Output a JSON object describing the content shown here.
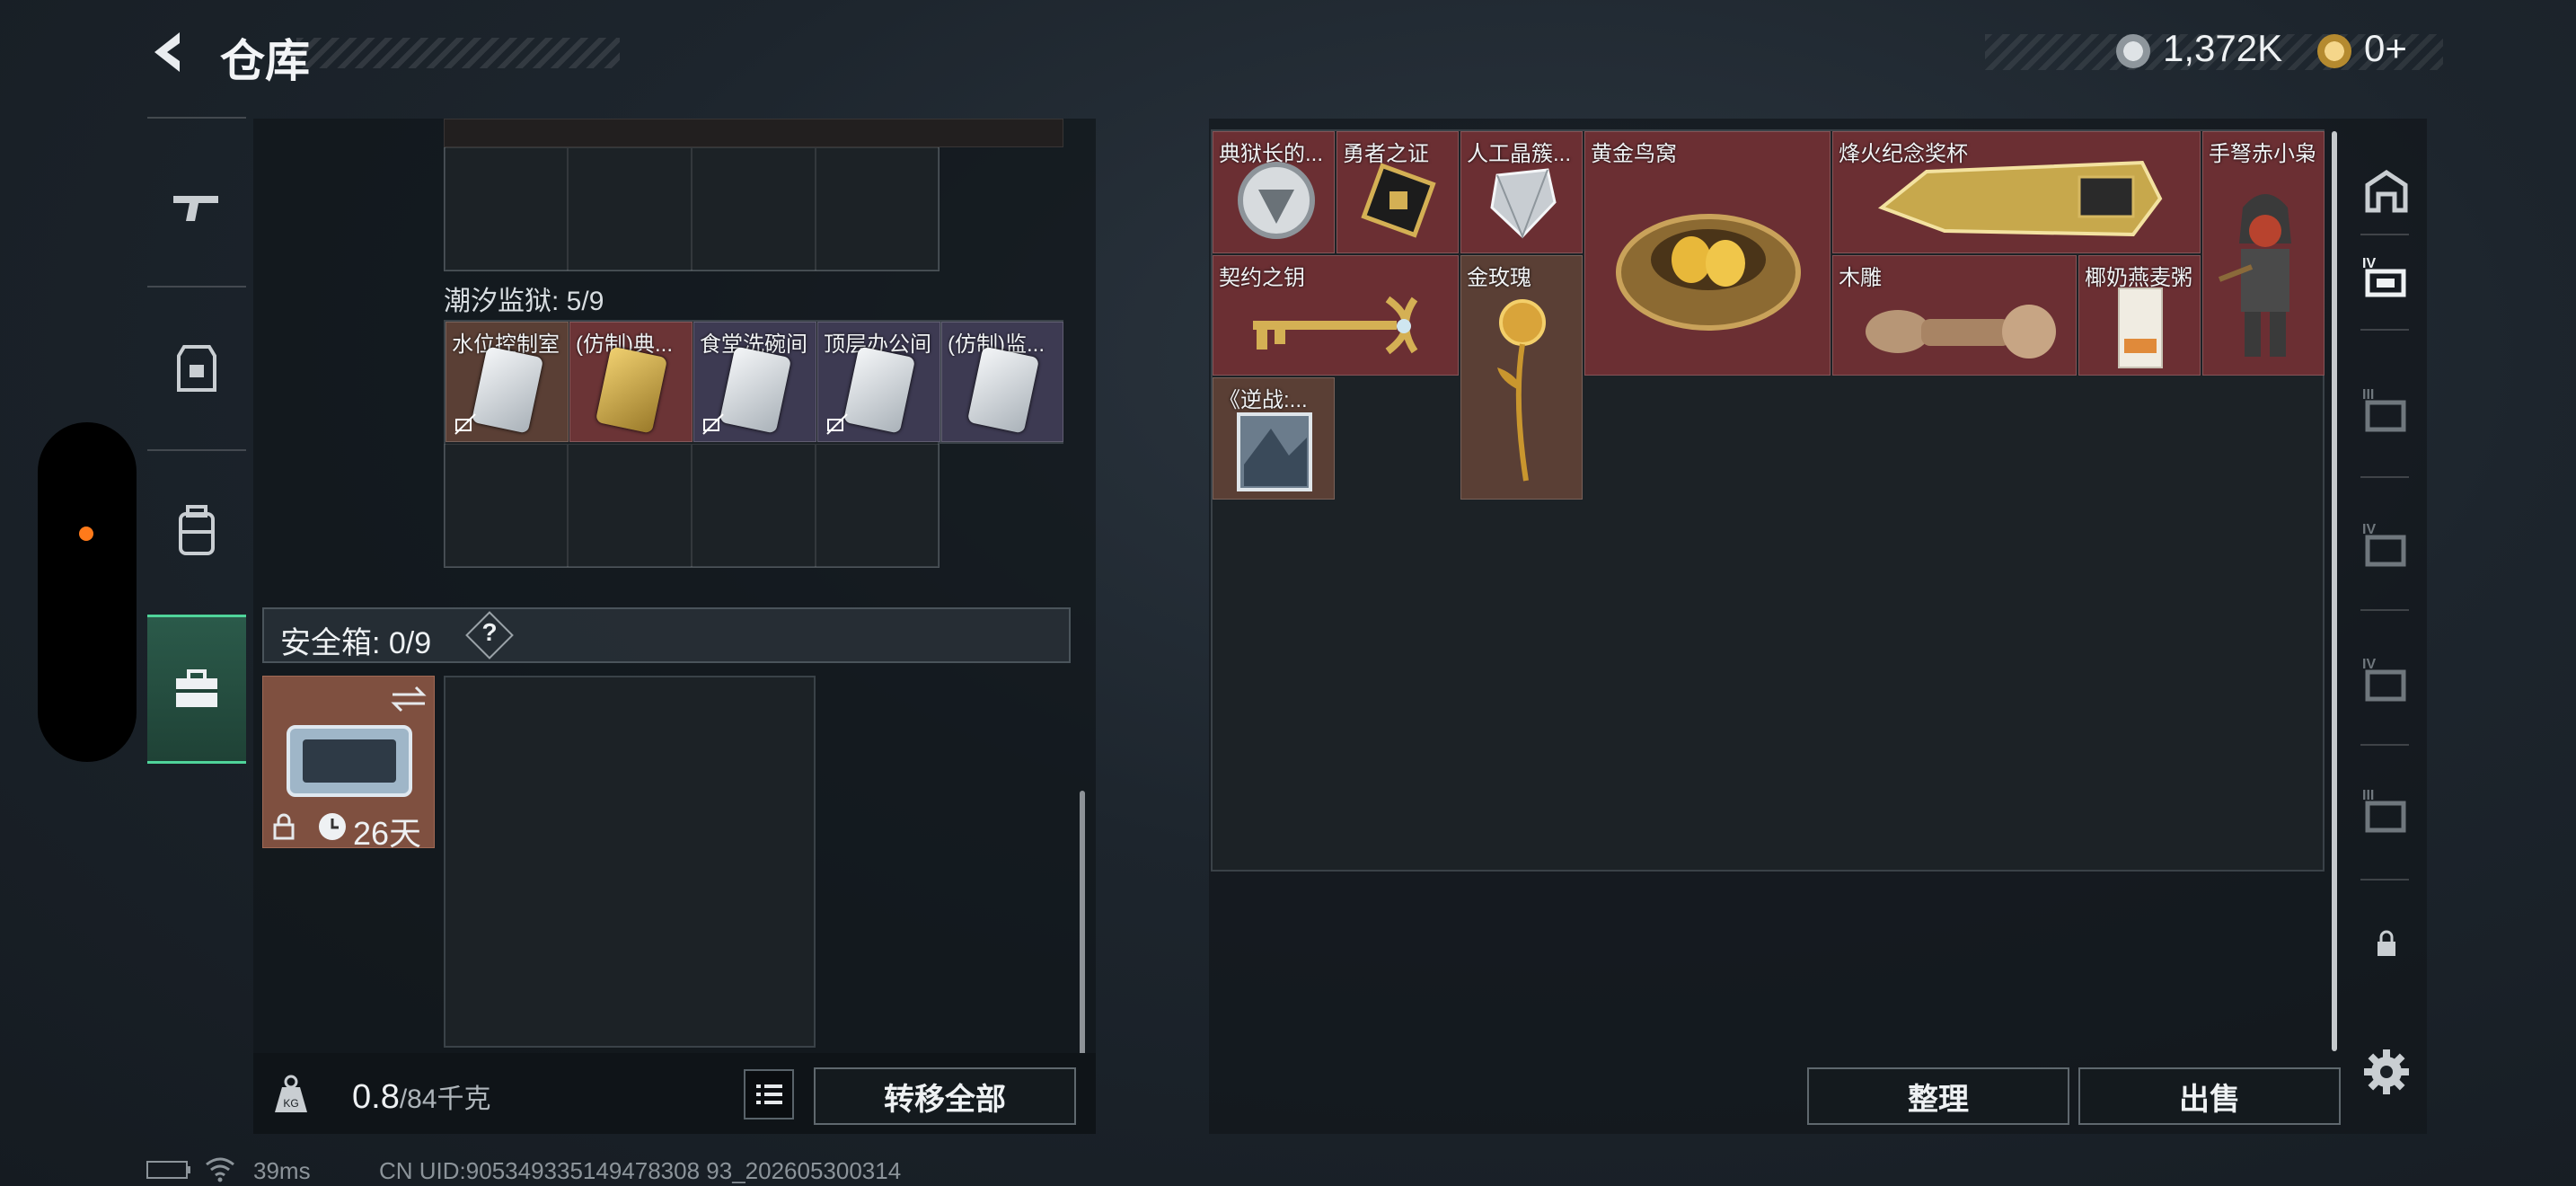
{
  "header": {
    "title": "仓库",
    "currency_silver": "1,372K",
    "currency_gold": "0+"
  },
  "left_nav": {
    "items": [
      "weapon",
      "armor",
      "backpack",
      "case"
    ],
    "active": "case"
  },
  "upper_container": {
    "title": "潮汐监狱: 5/9",
    "items": [
      {
        "label": "水位控制室",
        "tint": "#5a3f35"
      },
      {
        "label": "(仿制)典...",
        "tint": "#6b3436"
      },
      {
        "label": "食堂洗碗间",
        "tint": "#3d3a52"
      },
      {
        "label": "顶层办公间",
        "tint": "#3d3a52"
      },
      {
        "label": "(仿制)监...",
        "tint": "#3d3a52"
      }
    ]
  },
  "safe_box": {
    "title": "安全箱: 0/9",
    "help": "?",
    "duration": "26天"
  },
  "left_footer": {
    "weight_value": "0.8",
    "weight_max": "/84千克",
    "transfer_all": "转移全部"
  },
  "stash": {
    "items": [
      {
        "label": "典狱长的...",
        "tint": "#6b2f33"
      },
      {
        "label": "勇者之证",
        "tint": "#6b2f33"
      },
      {
        "label": "人工晶簇...",
        "tint": "#6b2f33"
      },
      {
        "label": "黄金鸟窝",
        "tint": "#6b2f33"
      },
      {
        "label": "烽火纪念奖杯",
        "tint": "#6b2f33"
      },
      {
        "label": "手弩赤小枭",
        "tint": "#6b2f33"
      },
      {
        "label": "契约之钥",
        "tint": "#6b2f33"
      },
      {
        "label": "金玫瑰",
        "tint": "#5a3f35"
      },
      {
        "label": "木雕",
        "tint": "#6b2f33"
      },
      {
        "label": "椰奶燕麦粥",
        "tint": "#6b2f33"
      },
      {
        "label": "《逆战:...",
        "tint": "#5a3f35"
      }
    ],
    "sort_label": "整理",
    "sell_label": "出售"
  },
  "right_nav": {
    "items": [
      "home",
      "IV-active",
      "III",
      "IV",
      "IV",
      "III",
      "lock",
      "settings"
    ]
  },
  "status_bar": {
    "ping": "39ms",
    "uid": "CN UID:905349335149478308 93_202605300314"
  }
}
